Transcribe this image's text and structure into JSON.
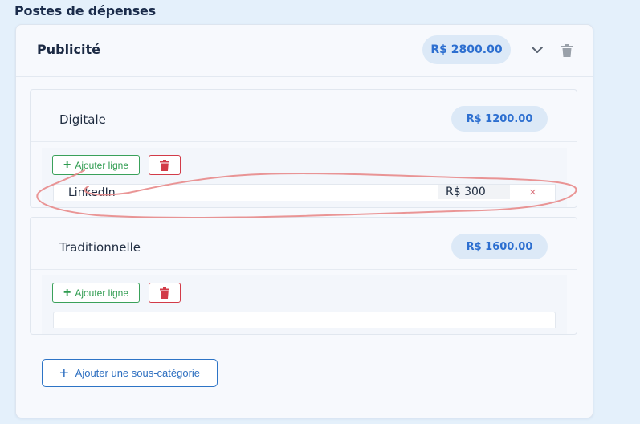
{
  "section": {
    "title": "Postes de dépenses"
  },
  "category": {
    "title": "Publicité",
    "total": "R$ 2800.00",
    "icons": {
      "expand": "chevron-down-icon",
      "delete": "trash-icon"
    }
  },
  "subcategories": [
    {
      "title": "Digitale",
      "total": "R$ 1200.00",
      "add_line_label": "Ajouter ligne",
      "lines": [
        {
          "name": "LinkedIn",
          "amount": "R$ 300",
          "remove": "×"
        }
      ]
    },
    {
      "title": "Traditionnelle",
      "total": "R$ 1600.00",
      "add_line_label": "Ajouter ligne",
      "lines": []
    }
  ],
  "add_subcategory_label": "Ajouter une sous-catégorie",
  "colors": {
    "accent_blue": "#2d6fd0",
    "pill_bg": "#dce9f7",
    "add_green": "#2e9b4f",
    "delete_red": "#d23b48",
    "annotation_red": "#e8898a"
  }
}
